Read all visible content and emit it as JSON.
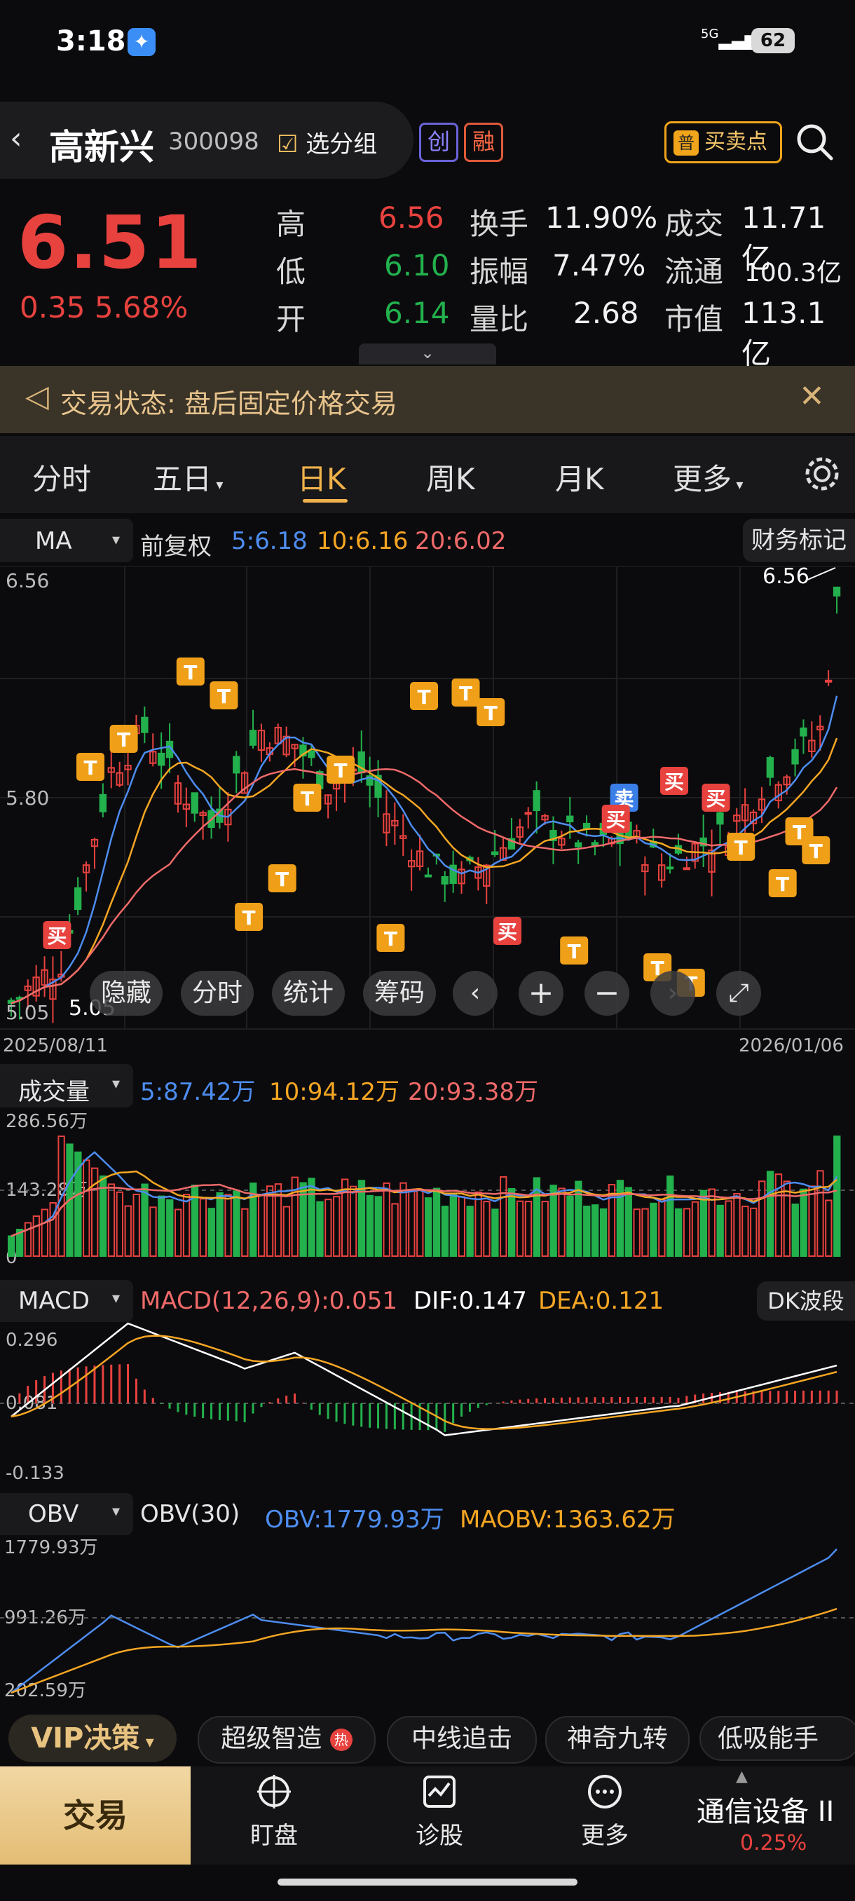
{
  "status_bar": {
    "time": "3:18",
    "signal": "5G",
    "battery": "62"
  },
  "header": {
    "stock_name": "高新兴",
    "stock_code": "300098",
    "group_label": "选分组",
    "badge_chuang": "创",
    "badge_rong": "融",
    "buysell_prefix": "普",
    "buysell_label": "买卖点"
  },
  "quote": {
    "price": "6.51",
    "change": "0.35",
    "change_pct": "5.68%",
    "high_label": "高",
    "high": "6.56",
    "low_label": "低",
    "low": "6.10",
    "open_label": "开",
    "open": "6.14",
    "turnover_label": "换手",
    "turnover": "11.90%",
    "amplitude_label": "振幅",
    "amplitude": "7.47%",
    "vol_ratio_label": "量比",
    "vol_ratio": "2.68",
    "amount_label": "成交",
    "amount": "11.71亿",
    "float_label": "流通",
    "float": "100.3亿",
    "mcap_label": "市值",
    "mcap": "113.1亿"
  },
  "notice": {
    "text": "交易状态: 盘后固定价格交易"
  },
  "tabs": [
    "分时",
    "五日",
    "日K",
    "周K",
    "月K",
    "更多"
  ],
  "kline": {
    "indicator": "MA",
    "adjust": "前复权",
    "ma5": "5:6.18",
    "ma10": "10:6.16",
    "ma20": "20:6.02",
    "fin_mark": "财务标记",
    "y_top": "6.56",
    "y_mid": "5.80",
    "y_low": "5.05",
    "max_label": "6.56",
    "min_label": "5.05",
    "date_start": "2025/08/11",
    "date_end": "2026/01/06",
    "colors": {
      "ma5": "#4d8df0",
      "ma10": "#f5a623",
      "ma20": "#f06a6a",
      "up": "#e8423f",
      "down": "#23b14d"
    }
  },
  "markers": {
    "t": "T",
    "buy": "买",
    "sell": "卖"
  },
  "float_toolbar": [
    "隐藏",
    "分时",
    "统计",
    "筹码"
  ],
  "volume": {
    "title": "成交量",
    "ma5": "5:87.42万",
    "ma10": "10:94.12万",
    "ma20": "20:93.38万",
    "y_top": "286.56万",
    "y_mid": "143.28万",
    "y_zero": "0"
  },
  "macd": {
    "title": "MACD",
    "params": "MACD(12,26,9):0.051",
    "dif": "DIF:0.147",
    "dea": "DEA:0.121",
    "wave_btn": "DK波段",
    "y_top": "0.296",
    "y_mid": "0.081",
    "y_low": "-0.133"
  },
  "obv": {
    "title": "OBV",
    "params": "OBV(30)",
    "obv": "OBV:1779.93万",
    "maobv": "MAOBV:1363.62万",
    "y_top": "1779.93万",
    "y_mid": "991.26万",
    "y_low": "202.59万"
  },
  "strategy_bar": {
    "vip": "VIP决策",
    "items": [
      "超级智造",
      "中线追击",
      "神奇九转",
      "低吸能手"
    ],
    "hot": "热"
  },
  "bottom_nav": {
    "trade": "交易",
    "items": [
      "盯盘",
      "诊股",
      "更多"
    ],
    "sector_name": "通信设备 II",
    "sector_change": "0.25%"
  }
}
